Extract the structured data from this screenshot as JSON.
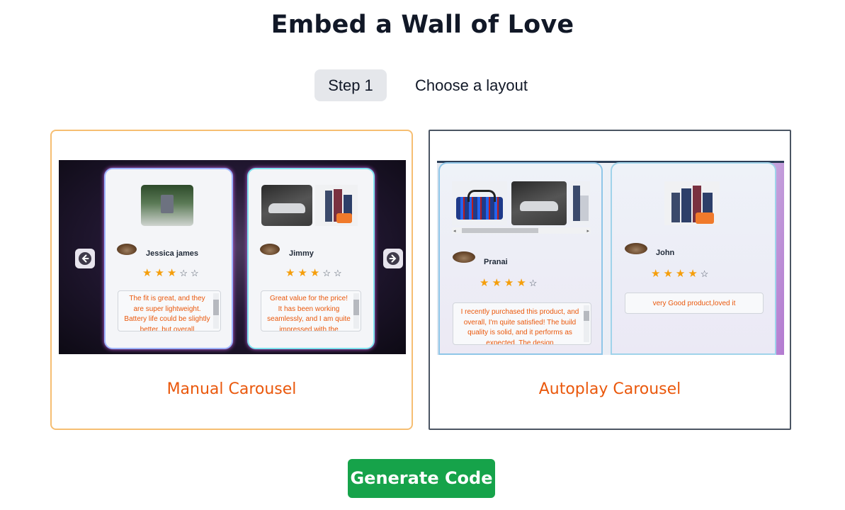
{
  "header": {
    "title": "Embed a Wall of Love"
  },
  "step": {
    "badge": "Step 1",
    "label": "Choose a layout"
  },
  "layouts": [
    {
      "title": "Manual Carousel",
      "selected": true,
      "preview": {
        "cards": [
          {
            "name": "Jessica james",
            "rating": 3,
            "review": "The fit is great, and they are super lightweight. Battery life could be slightly better, but overall"
          },
          {
            "name": "Jimmy",
            "rating": 3,
            "review": "Great value for the price! It has been working seamlessly, and I am quite impressed with the"
          }
        ]
      }
    },
    {
      "title": "Autoplay Carousel",
      "selected": false,
      "preview": {
        "cards": [
          {
            "name": "Pranai",
            "rating": 4,
            "review": "I recently purchased this product, and overall, I'm quite satisfied! The build quality is solid, and it performs as expected. The design"
          },
          {
            "name": "John",
            "rating": 4,
            "review": "very Good product,loved it"
          }
        ]
      }
    }
  ],
  "actions": {
    "generate_label": "Generate Code"
  },
  "colors": {
    "accent": "#ea580c",
    "selected_border": "#f6be72",
    "button": "#16a34a",
    "star": "#f59e0b"
  }
}
